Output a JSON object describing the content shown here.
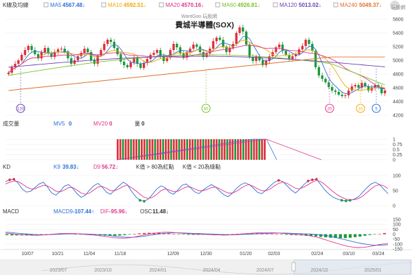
{
  "brand": {
    "watermark": "WantGoo 玩股網",
    "logo_text": "玩股網"
  },
  "title": "費城半導體(SOX)",
  "legend": [
    {
      "key": "kline",
      "label": "K線及均線",
      "value": "",
      "color": "#333333"
    },
    {
      "key": "ma5",
      "label": "MA5",
      "value": "4567.48↓",
      "color": "#2b6fd6"
    },
    {
      "key": "ma10",
      "label": "MA10",
      "value": "4592.51↓",
      "color": "#f0a800"
    },
    {
      "key": "ma20",
      "label": "MA20",
      "value": "4570.16↓",
      "color": "#e0338a"
    },
    {
      "key": "ma60",
      "label": "MA60",
      "value": "4926.81↓",
      "color": "#7bbf2a"
    },
    {
      "key": "ma120",
      "label": "MA120",
      "value": "5013.02↓",
      "color": "#6a3fb5"
    },
    {
      "key": "ma240",
      "label": "MA240",
      "value": "5049.37↓",
      "color": "#e0702a"
    }
  ],
  "markers": [
    {
      "label": "120",
      "color": "#6a3fb5"
    },
    {
      "label": "60",
      "color": "#7bbf2a"
    },
    {
      "label": "20",
      "color": "#e0338a"
    },
    {
      "label": "10",
      "color": "#f0a800"
    },
    {
      "label": "5",
      "color": "#2b6fd6"
    }
  ],
  "volume_panel": {
    "title": "成交量",
    "mv5_label": "MV5",
    "mv5_value": "0",
    "mv20_label": "MV20",
    "mv20_value": "0",
    "vol_label": "量",
    "vol_value": "0",
    "mv5_color": "#2b6fd6",
    "mv20_color": "#e0338a"
  },
  "kd_panel": {
    "title": "KD",
    "k_label": "K9",
    "k_value": "39.83↓",
    "d_label": "D9",
    "d_value": "56.72↓",
    "note1": "K值 > 80為紅點",
    "note2": "K值 < 20為綠點",
    "k_color": "#2b6fd6",
    "d_color": "#e0338a"
  },
  "macd_panel": {
    "title": "MACD",
    "macd_label": "MACD9",
    "macd_value": "-107.44↑",
    "dif_label": "DIF",
    "dif_value": "-95.96↓",
    "osc_label": "OSC",
    "osc_value": "11.48↓",
    "macd_color": "#2b6fd6",
    "dif_color": "#e0338a"
  },
  "chart_data": [
    {
      "type": "candlestick",
      "title": "費城半導體(SOX)",
      "ylim": [
        4200,
        5600
      ],
      "yticks": [
        4200,
        4400,
        4600,
        4800,
        5000,
        5200,
        5400,
        5600
      ],
      "xticks": [
        "10/07",
        "10/21",
        "11/04",
        "11/18",
        "12/09",
        "12/30",
        "01/20",
        "02/03",
        "02/24",
        "03/10",
        "03/24"
      ],
      "close": [
        4820,
        4900,
        4950,
        5000,
        5080,
        5150,
        5210,
        5150,
        5090,
        5030,
        5120,
        5180,
        5100,
        5050,
        5120,
        5160,
        5170,
        5130,
        5030,
        4950,
        5000,
        5060,
        5110,
        5170,
        5120,
        5000,
        4950,
        5070,
        5150,
        5240,
        5300,
        5270,
        5180,
        5090,
        4980,
        4930,
        4900,
        4970,
        5030,
        4950,
        4890,
        4960,
        5020,
        5080,
        5110,
        5150,
        5060,
        4990,
        5040,
        5150,
        5240,
        5190,
        5100,
        5040,
        5120,
        5170,
        5230,
        5200,
        5120,
        5050,
        5100,
        5170,
        5280,
        5330,
        5300,
        5200,
        5120,
        5180,
        5240,
        5400,
        5480,
        5420,
        5230,
        5050,
        4990,
        5060,
        5000,
        4930,
        4990,
        5060,
        5120,
        5190,
        5230,
        5140,
        5080,
        5020,
        5060,
        5090,
        5160,
        5210,
        5300,
        5240,
        5140,
        4900,
        4780,
        4730,
        4680,
        4610,
        4560,
        4540,
        4500,
        4480,
        4490,
        4560,
        4620,
        4640,
        4600,
        4670,
        4620,
        4560,
        4600,
        4640,
        4600,
        4520,
        4560
      ],
      "ma_lines": {
        "MA5": "4567.48",
        "MA10": "4592.51",
        "MA20": "4570.16",
        "MA60": "4926.81",
        "MA120": "5013.02",
        "MA240": "5049.37"
      }
    },
    {
      "type": "bar",
      "title": "成交量",
      "ylim": [
        0,
        1
      ],
      "yticks": [
        0,
        0.25,
        0.5,
        0.75,
        1
      ],
      "values_description": "volume bars from 11/18 to 02/03",
      "values": [
        1,
        1,
        1,
        1,
        1,
        1,
        1,
        1,
        1,
        1,
        1,
        1,
        1,
        1,
        1,
        1,
        1,
        1,
        1,
        1,
        1,
        1,
        1,
        1,
        1,
        1,
        1,
        1,
        1,
        1,
        1,
        1,
        1,
        1,
        1,
        1,
        1,
        1,
        1,
        1,
        1,
        1,
        1,
        1,
        1,
        1,
        1,
        1,
        1,
        1,
        1,
        1,
        1,
        1,
        1,
        1
      ],
      "MV5": 0,
      "MV20": 0
    },
    {
      "type": "line",
      "title": "KD",
      "ylim": [
        0,
        100
      ],
      "yticks": [
        0,
        50,
        100
      ],
      "series": [
        {
          "name": "K9",
          "values": [
            80,
            86,
            88,
            75,
            55,
            45,
            48,
            60,
            72,
            78,
            62,
            42,
            35,
            48,
            65,
            70,
            58,
            40,
            28,
            35,
            52,
            66,
            74,
            62,
            45,
            38,
            52,
            66,
            78,
            70,
            48,
            30,
            18,
            15,
            22,
            38,
            56,
            66,
            60,
            44,
            38,
            52,
            68,
            72,
            60,
            46,
            40,
            52,
            62,
            70,
            62,
            48,
            36,
            30,
            42,
            58,
            70,
            76,
            70,
            58,
            44,
            40,
            52,
            66,
            78,
            84,
            80,
            66,
            52,
            42,
            55,
            70,
            82,
            86,
            88,
            70,
            52,
            38,
            28,
            22,
            18,
            16,
            18,
            22,
            30,
            45,
            60,
            72,
            78,
            70,
            55,
            39.83
          ]
        },
        {
          "name": "D9",
          "values": [
            72,
            78,
            82,
            80,
            72,
            62,
            56,
            56,
            62,
            68,
            66,
            58,
            48,
            46,
            52,
            60,
            60,
            52,
            42,
            38,
            42,
            52,
            62,
            64,
            58,
            50,
            50,
            56,
            64,
            68,
            60,
            50,
            38,
            28,
            24,
            28,
            38,
            50,
            56,
            52,
            46,
            48,
            56,
            62,
            62,
            56,
            50,
            50,
            54,
            60,
            62,
            56,
            48,
            42,
            42,
            48,
            58,
            66,
            70,
            64,
            56,
            50,
            50,
            56,
            66,
            74,
            78,
            74,
            66,
            58,
            56,
            62,
            70,
            78,
            84,
            80,
            70,
            58,
            46,
            36,
            28,
            22,
            20,
            20,
            24,
            32,
            44,
            56,
            66,
            70,
            66,
            56.72
          ]
        }
      ]
    },
    {
      "type": "line",
      "title": "MACD",
      "ylim": [
        -150,
        150
      ],
      "yticks": [
        -150,
        -100,
        -50,
        0,
        50,
        100,
        150
      ],
      "series": [
        {
          "name": "MACD9",
          "values": [
            20,
            18,
            12,
            8,
            4,
            0,
            -4,
            -6,
            -6,
            -4,
            -2,
            0,
            2,
            3,
            4,
            3,
            2,
            0,
            -2,
            -4,
            -8,
            -14,
            -20,
            -26,
            -30,
            -32,
            -30,
            -26,
            -20,
            -12,
            -4,
            2,
            8,
            12,
            14,
            14,
            12,
            10,
            8,
            6,
            4,
            2,
            0,
            -2,
            -4,
            -6,
            -6,
            -4,
            -2,
            0,
            2,
            4,
            6,
            8,
            10,
            12,
            12,
            10,
            8,
            6,
            4,
            2,
            0,
            -4,
            -10,
            -18,
            -28,
            -40,
            -52,
            -64,
            -76,
            -88,
            -98,
            -105,
            -110,
            -112,
            -110,
            -107.44
          ]
        },
        {
          "name": "DIF",
          "values": [
            10,
            6,
            0,
            -4,
            -8,
            -10,
            -12,
            -10,
            -6,
            -2,
            2,
            6,
            8,
            8,
            6,
            2,
            -2,
            -6,
            -10,
            -16,
            -22,
            -30,
            -36,
            -40,
            -40,
            -36,
            -28,
            -18,
            -8,
            2,
            10,
            16,
            20,
            20,
            16,
            12,
            8,
            4,
            2,
            0,
            -2,
            -4,
            -6,
            -8,
            -10,
            -8,
            -4,
            0,
            4,
            8,
            12,
            14,
            16,
            16,
            14,
            12,
            8,
            4,
            0,
            -4,
            -8,
            -14,
            -22,
            -34,
            -50,
            -66,
            -82,
            -98,
            -112,
            -124,
            -132,
            -136,
            -134,
            -128,
            -118,
            -108,
            -100,
            -95.96
          ]
        },
        {
          "name": "OSC",
          "values": [
            -10,
            -12,
            -12,
            -12,
            -12,
            -10,
            -8,
            -4,
            0,
            2,
            4,
            6,
            6,
            5,
            2,
            -1,
            -4,
            -6,
            -8,
            -12,
            -14,
            -16,
            -16,
            -14,
            -10,
            -4,
            2,
            8,
            12,
            14,
            14,
            14,
            12,
            8,
            2,
            -2,
            -4,
            -6,
            -6,
            -6,
            -6,
            -6,
            -6,
            -6,
            -6,
            -2,
            2,
            4,
            6,
            8,
            10,
            10,
            10,
            8,
            4,
            0,
            -4,
            -6,
            -8,
            -10,
            -12,
            -16,
            -18,
            -22,
            -28,
            -32,
            -36,
            -38,
            -40,
            -40,
            -36,
            -30,
            -24,
            -16,
            -8,
            -2,
            4,
            11.48
          ]
        }
      ]
    }
  ],
  "timeline": {
    "labels": [
      "2023/07",
      "2023/10",
      "2024/01",
      "2024/04",
      "2024/07",
      "2024/10",
      "2025/01"
    ]
  }
}
